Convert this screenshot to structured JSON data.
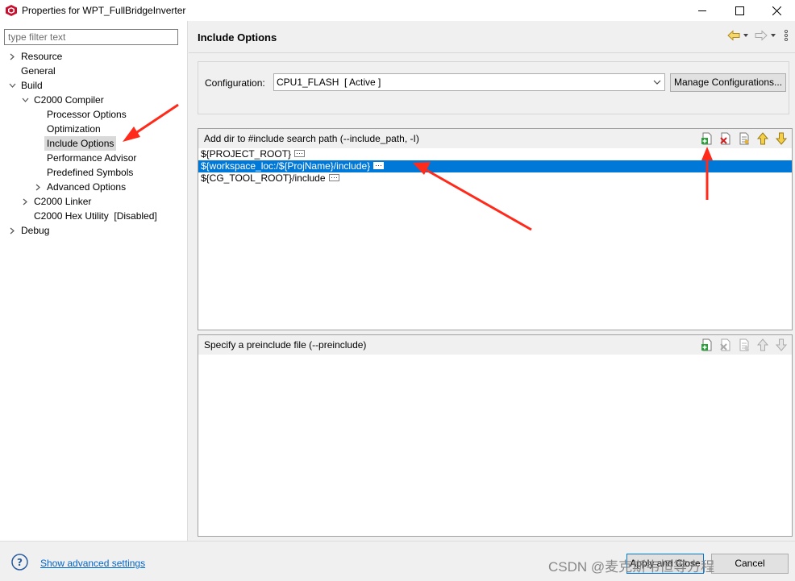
{
  "window": {
    "title": "Properties for WPT_FullBridgeInverter",
    "controls": [
      "minimize-icon",
      "maximize-icon",
      "close-icon"
    ]
  },
  "sidebar": {
    "filter_placeholder": "type filter text",
    "items": [
      {
        "label": "Resource",
        "level": 0,
        "twisty": "collapsed"
      },
      {
        "label": "General",
        "level": 0,
        "twisty": "none"
      },
      {
        "label": "Build",
        "level": 0,
        "twisty": "expanded"
      },
      {
        "label": "C2000 Compiler",
        "level": 1,
        "twisty": "expanded"
      },
      {
        "label": "Processor Options",
        "level": 2,
        "twisty": "none"
      },
      {
        "label": "Optimization",
        "level": 2,
        "twisty": "none"
      },
      {
        "label": "Include Options",
        "level": 2,
        "twisty": "none",
        "selected": true
      },
      {
        "label": "Performance Advisor",
        "level": 2,
        "twisty": "none"
      },
      {
        "label": "Predefined Symbols",
        "level": 2,
        "twisty": "none"
      },
      {
        "label": "Advanced Options",
        "level": 2,
        "twisty": "collapsed"
      },
      {
        "label": "C2000 Linker",
        "level": 1,
        "twisty": "collapsed"
      },
      {
        "label": "C2000 Hex Utility  [Disabled]",
        "level": 1,
        "twisty": "none"
      },
      {
        "label": "Debug",
        "level": 0,
        "twisty": "collapsed"
      }
    ]
  },
  "main": {
    "title": "Include Options",
    "configuration": {
      "label": "Configuration:",
      "value": "CPU1_FLASH  [ Active ]",
      "manage_label": "Manage Configurations..."
    },
    "include_panel": {
      "label": "Add dir to #include search path (--include_path, -I)",
      "paths": [
        {
          "text": "${PROJECT_ROOT}",
          "selected": false
        },
        {
          "text": "${workspace_loc:/${ProjName}/include}",
          "selected": true
        },
        {
          "text": "${CG_TOOL_ROOT}/include",
          "selected": false
        }
      ],
      "tools": [
        "add-icon",
        "delete-icon",
        "edit-icon",
        "move-up-icon",
        "move-down-icon"
      ]
    },
    "preinclude_panel": {
      "label": "Specify a preinclude file (--preinclude)",
      "tools": [
        "add-icon",
        "delete-icon",
        "edit-icon",
        "move-up-icon",
        "move-down-icon"
      ]
    }
  },
  "footer": {
    "advanced_link": "Show advanced settings",
    "apply_label": "Apply and Close",
    "cancel_label": "Cancel",
    "watermark": "CSDN @麦克斯韦恒等方程"
  },
  "colors": {
    "selection": "#0078d7",
    "annotation_arrow": "#ff2a1a",
    "link": "#0066cc"
  }
}
